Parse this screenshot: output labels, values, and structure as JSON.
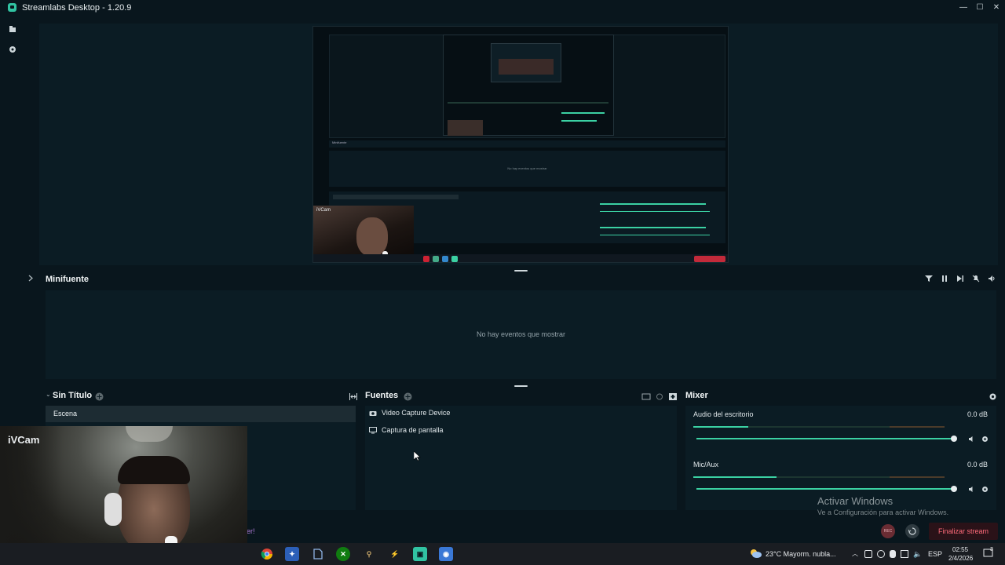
{
  "window": {
    "title": "Streamlabs Desktop - 1.20.9",
    "controls": {
      "minimize": "—",
      "maximize": "☐",
      "close": "✕"
    }
  },
  "nav": {
    "item1_icon": "files-icon",
    "item2_icon": "record-icon"
  },
  "minifuente": {
    "title": "Minifuente",
    "empty_message": "No hay eventos que mostrar",
    "toolbar": [
      "filter-icon",
      "pause-icon",
      "skip-icon",
      "mute-alerts-icon",
      "volume-icon"
    ]
  },
  "scenes": {
    "collection_title": "Sin Título",
    "items": [
      "Escena"
    ]
  },
  "sources": {
    "title": "Fuentes",
    "items": [
      {
        "label": "Video Capture Device",
        "icon": "camera-icon"
      },
      {
        "label": "Captura de pantalla",
        "icon": "monitor-icon"
      }
    ]
  },
  "mixer": {
    "title": "Mixer",
    "channels": [
      {
        "label": "Audio del escritorio",
        "db": "0.0 dB",
        "level": 0.22,
        "volume": 1.0
      },
      {
        "label": "Mic/Aux",
        "db": "0.0 dB",
        "level": 0.33,
        "volume": 1.0
      }
    ]
  },
  "webcam": {
    "label": "iVCam"
  },
  "watermark": {
    "title": "Activar Windows",
    "subtitle": "Ve a Configuración para activar Windows."
  },
  "footer": {
    "rec_label": "REC",
    "end_stream_label": "Finalizar stream",
    "partial_text": "er!"
  },
  "taskbar": {
    "weather": "23°C  Mayorm. nubla...",
    "language": "ESP",
    "time": "02:55",
    "date": "2/4/2026",
    "notification_count": "3"
  },
  "preview": {
    "nested_cam_label": "iVCam",
    "nested_title": "Minifuente",
    "nested_empty": "No hay eventos que mostrar"
  },
  "colors": {
    "accent": "#31c3a2",
    "danger": "#ff6b7a",
    "panel": "#0b1c24",
    "bg": "#09161d"
  }
}
